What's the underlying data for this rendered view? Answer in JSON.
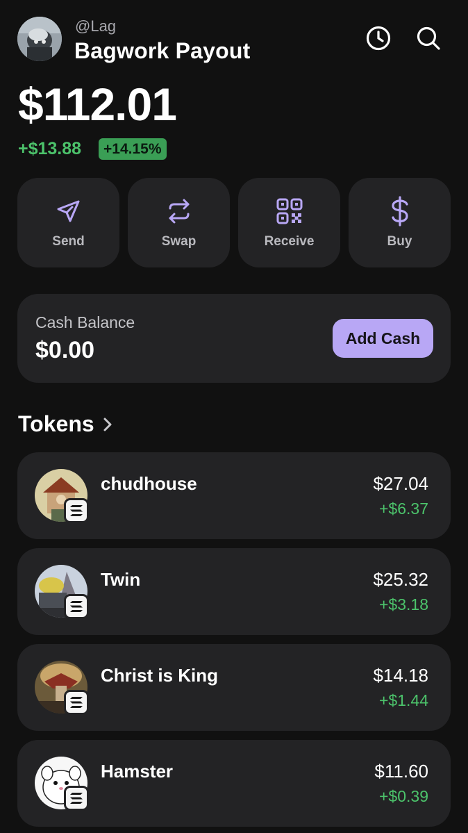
{
  "header": {
    "handle": "@Lag",
    "wallet_name": "Bagwork Payout",
    "icons": [
      "history-icon",
      "search-icon"
    ]
  },
  "portfolio": {
    "total": "$112.01",
    "change_abs": "+$13.88",
    "change_pct": "+14.15%"
  },
  "actions": [
    {
      "label": "Send",
      "icon": "send-icon"
    },
    {
      "label": "Swap",
      "icon": "swap-icon"
    },
    {
      "label": "Receive",
      "icon": "qr-code-icon"
    },
    {
      "label": "Buy",
      "icon": "dollar-icon"
    }
  ],
  "cash": {
    "label": "Cash Balance",
    "value": "$0.00",
    "button": "Add Cash"
  },
  "tokens": {
    "title": "Tokens",
    "items": [
      {
        "name": "chudhouse",
        "value": "$27.04",
        "change": "+$6.37"
      },
      {
        "name": "Twin",
        "value": "$25.32",
        "change": "+$3.18"
      },
      {
        "name": "Christ is King",
        "value": "$14.18",
        "change": "+$1.44"
      },
      {
        "name": "Hamster",
        "value": "$11.60",
        "change": "+$0.39"
      }
    ]
  },
  "colors": {
    "background": "#111111",
    "card": "#232325",
    "accent": "#b8a7f5",
    "positive": "#4cc36b"
  }
}
